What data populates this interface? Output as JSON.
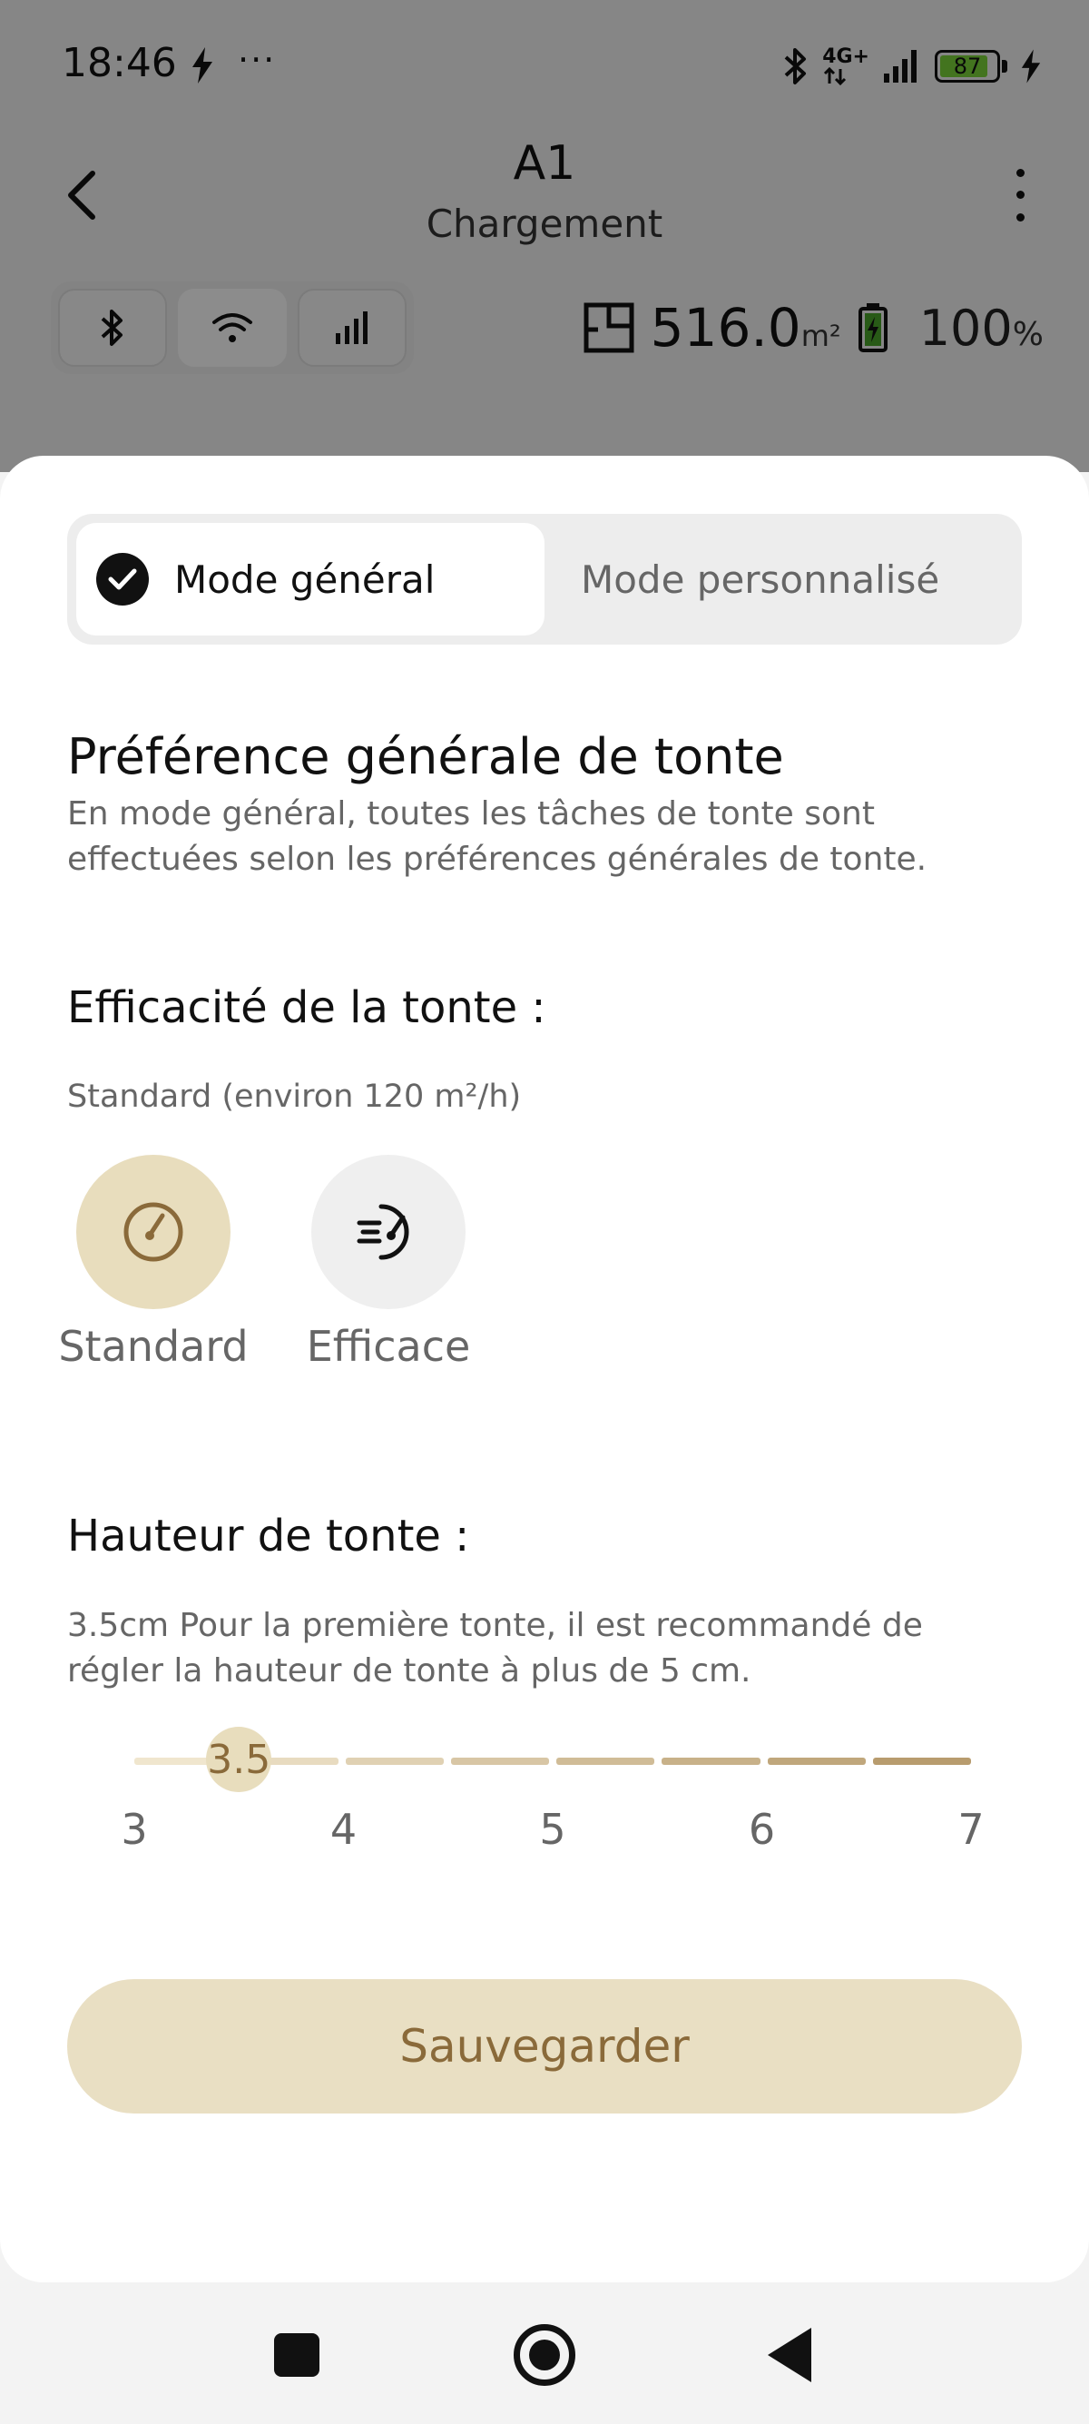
{
  "status_bar": {
    "time": "18:46",
    "dots": "···",
    "network": "4G+",
    "battery": "87"
  },
  "header": {
    "title": "A1",
    "subtitle": "Chargement"
  },
  "connectivity": {
    "icons": [
      "bluetooth-icon",
      "wifi-icon",
      "signal-icon"
    ]
  },
  "stats": {
    "area_value": "516.0",
    "area_unit": "m²",
    "battery_value": "100",
    "battery_unit": "%"
  },
  "mode_selector": {
    "general": "Mode général",
    "custom": "Mode personnalisé",
    "selected": "general"
  },
  "preference": {
    "title": "Préférence générale de tonte",
    "description": "En mode général, toutes les tâches de tonte sont effectuées selon les préférences générales de tonte."
  },
  "efficiency": {
    "label": "Efficacité de la tonte :",
    "current": "Standard (environ 120 m²/h)",
    "options": [
      {
        "label": "Standard",
        "icon": "gauge-icon",
        "selected": true
      },
      {
        "label": "Efficace",
        "icon": "fast-gauge-icon",
        "selected": false
      }
    ]
  },
  "height": {
    "label": "Hauteur de tonte :",
    "description": "3.5cm Pour la première tonte, il est recommandé de régler la hauteur de tonte à plus de 5 cm.",
    "min": 3,
    "max": 7,
    "value": 3.5,
    "value_label": "3.5",
    "ticks": [
      "3",
      "4",
      "5",
      "6",
      "7"
    ]
  },
  "actions": {
    "save": "Sauvegarder"
  },
  "colors": {
    "accent": "#8a6a3a",
    "accent_light": "#e9dfc3",
    "selected_circle": "#e8ddbd",
    "battery_green": "#7bd43a"
  }
}
